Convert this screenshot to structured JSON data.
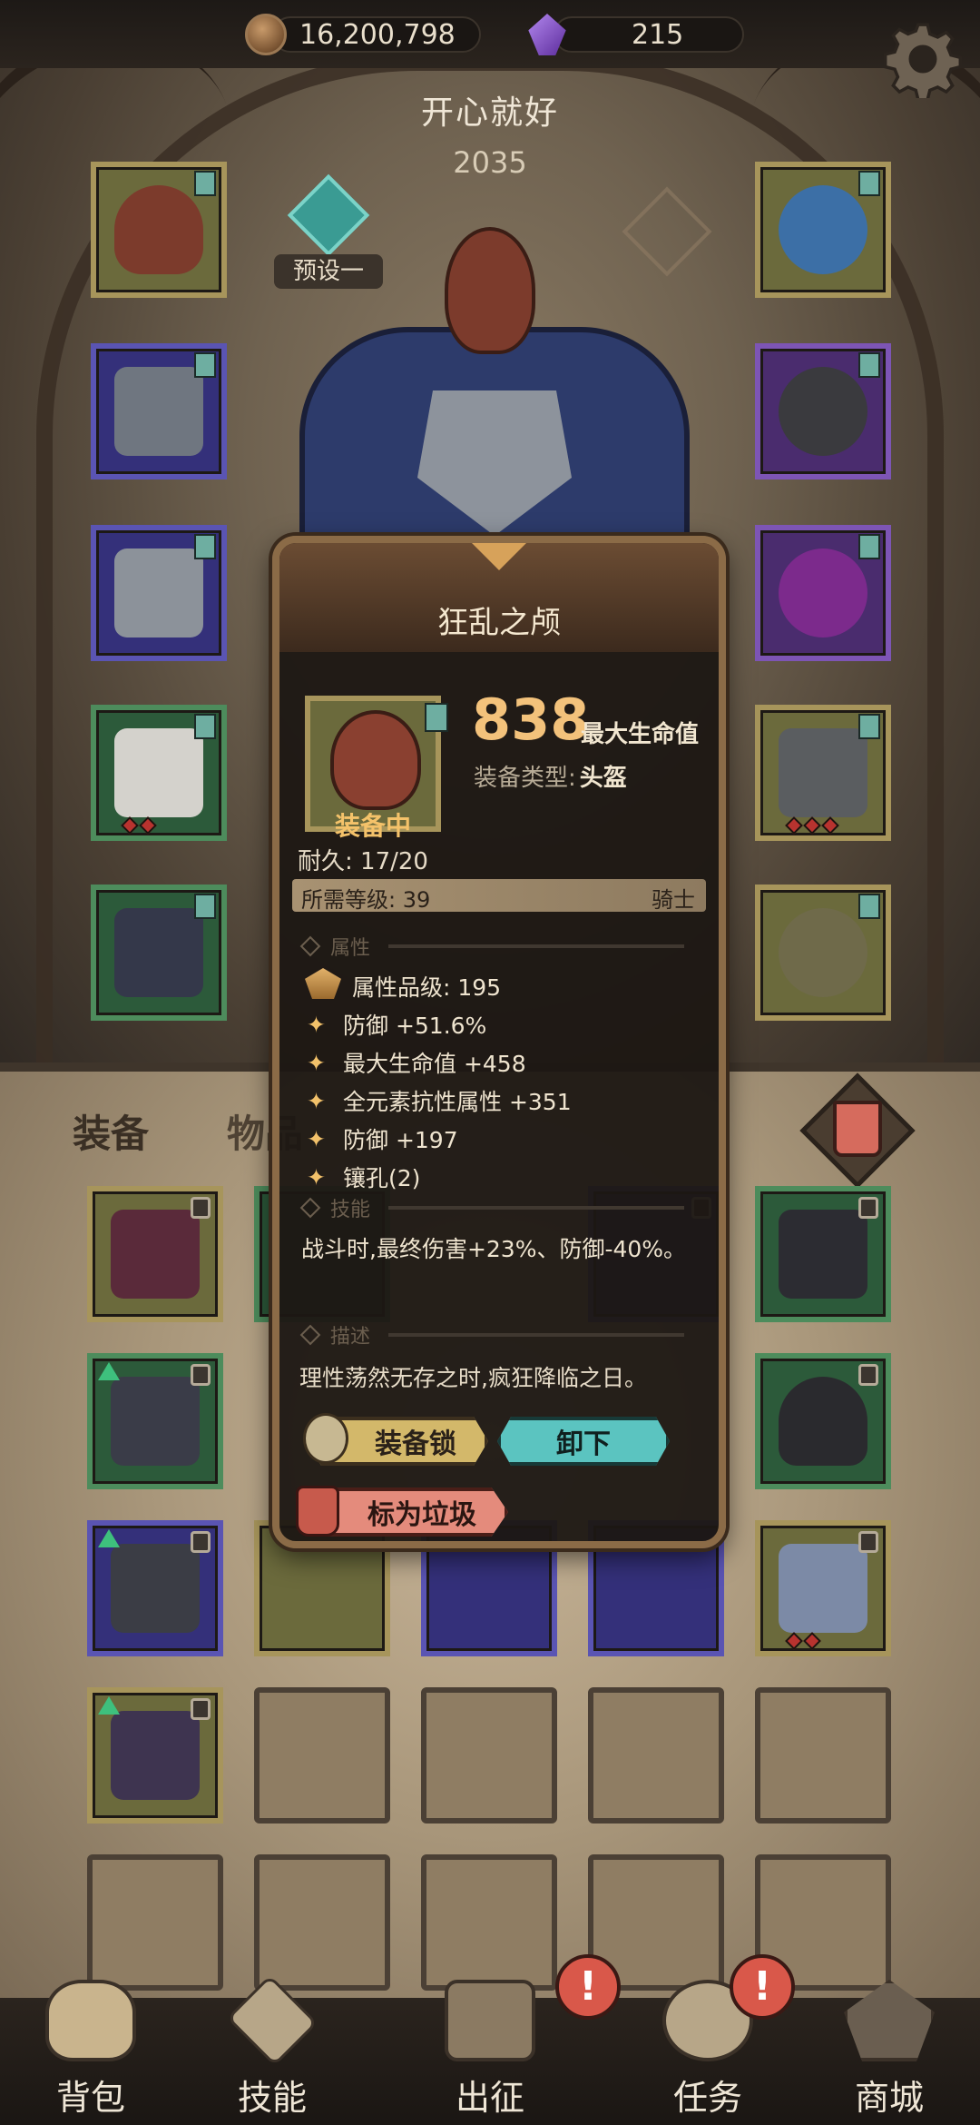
{
  "currency": {
    "coins": "16,200,798",
    "gems": "215",
    "coin_icon": "coin-icon",
    "gem_icon": "purple-crystal-icon"
  },
  "character": {
    "name": "开心就好",
    "level": "2035",
    "preset_label": "预设一"
  },
  "equipment_slots_left": [
    {
      "name": "helmet-slot",
      "quality": "gold",
      "icon": "sack-helmet"
    },
    {
      "name": "chest-slot",
      "quality": "blue",
      "icon": "chest-armor"
    },
    {
      "name": "gloves-slot",
      "quality": "blue",
      "icon": "gauntlet"
    },
    {
      "name": "pants-slot",
      "quality": "green",
      "icon": "pants"
    },
    {
      "name": "boots-slot",
      "quality": "green",
      "icon": "boots"
    }
  ],
  "equipment_slots_right": [
    {
      "name": "amulet-slot",
      "quality": "gold",
      "icon": "amulet"
    },
    {
      "name": "ring1-slot",
      "quality": "purple",
      "icon": "ring"
    },
    {
      "name": "ring2-slot",
      "quality": "purple",
      "icon": "ring-purple"
    },
    {
      "name": "weapon-slot",
      "quality": "gold",
      "icon": "rapier"
    },
    {
      "name": "offhand-slot",
      "quality": "gold",
      "icon": "skull-shield"
    }
  ],
  "bag": {
    "tab_equip": "装备",
    "tab_items": "物品"
  },
  "popup": {
    "title": "狂乱之颅",
    "main_stat_value": "838",
    "main_stat_label": "最大生命值",
    "type_key": "装备类型:",
    "type_value": "头盔",
    "equipped_label": "装备中",
    "durability": "耐久: 17/20",
    "required_level": "所需等级: 39",
    "class": "骑士",
    "attributes_header": "属性",
    "attr_grade": "属性品级: 195",
    "attributes": [
      "防御 +51.6%",
      "最大生命值 +458",
      "全元素抗性属性 +351",
      "防御 +197",
      "镶孔(2)"
    ],
    "skill_header": "技能",
    "skill_text": "战斗时,最终伤害+23%、防御-40%。",
    "desc_header": "描述",
    "desc_text": "理性荡然无存之时,疯狂降临之日。",
    "lock_button": "装备锁",
    "unequip_button": "卸下",
    "junk_button": "标为垃圾"
  },
  "nav": {
    "bag": "背包",
    "skills": "技能",
    "expedition": "出征",
    "quests": "任务",
    "shop": "商城",
    "alert_mark": "!"
  },
  "colors": {
    "gold_frame": "#a7955b",
    "blue_frame": "#5a54b3",
    "green_frame": "#4d8c5c",
    "accent_orange": "#f3c27b",
    "unequip_teal": "#5bc4c0",
    "junk_red": "#e48b7c"
  }
}
